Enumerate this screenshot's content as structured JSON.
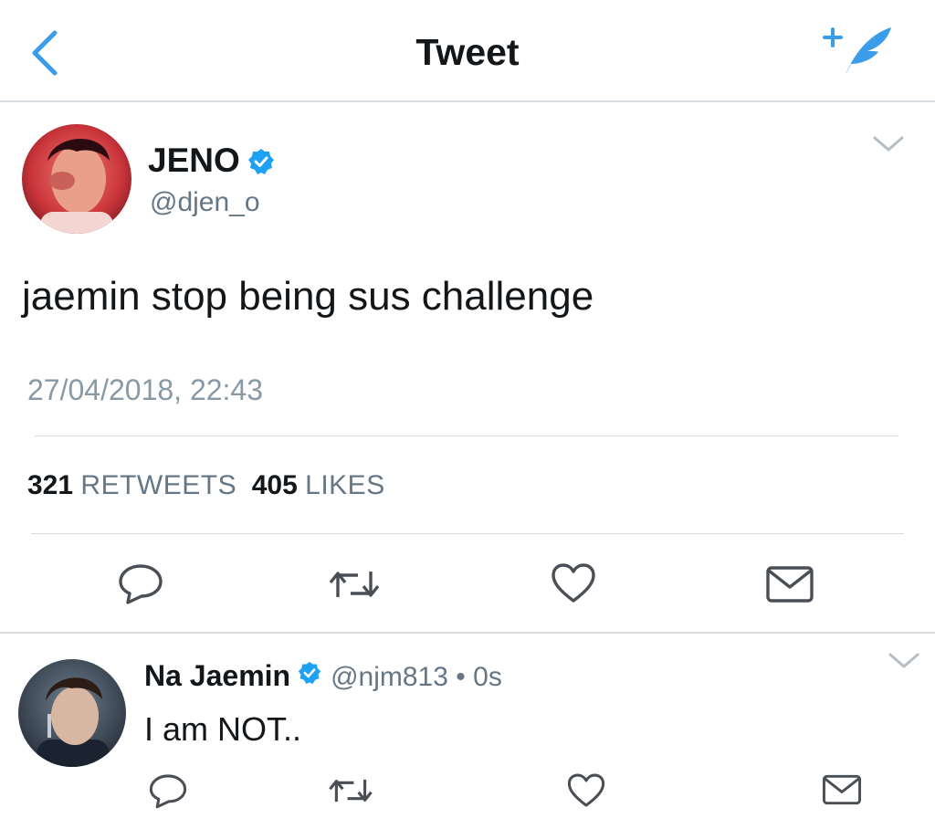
{
  "nav": {
    "title": "Tweet",
    "back_icon": "chevron-left-icon",
    "compose_icon": "compose-tweet-icon",
    "accent_color": "#3b9dea"
  },
  "main_tweet": {
    "name": "JENO",
    "handle": "@djen_o",
    "text": "jaemin stop being sus challenge",
    "timestamp": "27/04/2018, 22:43",
    "retweets_count": "321",
    "retweets_label": "RETWEETS",
    "likes_count": "405",
    "likes_label": "LIKES",
    "verified": true,
    "actions": [
      "reply-icon",
      "retweet-icon",
      "like-icon",
      "message-icon"
    ]
  },
  "reply_tweet": {
    "name": "Na Jaemin",
    "handle": "@njm813",
    "separator": "•",
    "time": "0s",
    "text": "I am NOT..",
    "verified": true,
    "actions": [
      "reply-icon",
      "retweet-icon",
      "like-icon",
      "message-icon"
    ]
  },
  "colors": {
    "text_primary": "#14171a",
    "text_secondary": "#657786",
    "divider": "#d8dde1",
    "verified_blue": "#1da1f2",
    "icon_gray": "#4a4f55"
  }
}
